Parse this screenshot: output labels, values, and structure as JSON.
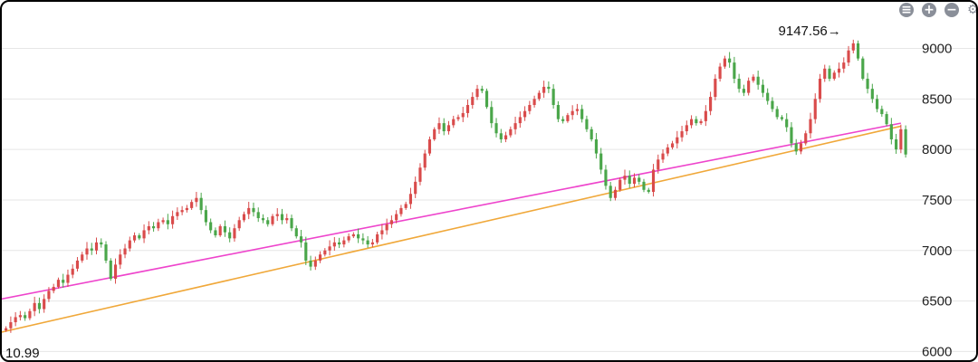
{
  "toolbar": {
    "buttons": [
      {
        "name": "menu-icon",
        "glyph": "≡"
      },
      {
        "name": "zoom-in-icon",
        "glyph": "+"
      },
      {
        "name": "zoom-out-icon",
        "glyph": "−"
      },
      {
        "name": "settings-icon",
        "glyph": "⚙"
      }
    ]
  },
  "chart_data": {
    "type": "candlestick",
    "y_axis": {
      "min": 5950,
      "max": 9300,
      "ticks": [
        6000,
        6500,
        7000,
        7500,
        8000,
        8500,
        9000
      ],
      "position": "right"
    },
    "grid": true,
    "colors": {
      "up": "#d94b4b",
      "down": "#4aa64a",
      "trendline_1": "#ee44cc",
      "trendline_2": "#f0a83a"
    },
    "annotations": [
      {
        "text": "9147.56→",
        "index": 176,
        "value": 9147.56,
        "kind": "max"
      },
      {
        "text": "10.99",
        "index": 0,
        "value": 6210.99,
        "kind": "min"
      }
    ],
    "trendlines": [
      {
        "name": "",
        "start": {
          "index": -2,
          "value": 6510
        },
        "end": {
          "index": 188,
          "value": 8260
        }
      },
      {
        "name": "",
        "start": {
          "index": -2,
          "value": 6180
        },
        "end": {
          "index": 188,
          "value": 8230
        }
      }
    ],
    "closes": [
      6230,
      6290,
      6340,
      6360,
      6330,
      6400,
      6480,
      6420,
      6520,
      6600,
      6640,
      6710,
      6680,
      6760,
      6820,
      6900,
      6960,
      7020,
      7000,
      7080,
      7060,
      6900,
      6720,
      6860,
      6960,
      7020,
      7100,
      7150,
      7120,
      7200,
      7240,
      7220,
      7280,
      7300,
      7260,
      7340,
      7380,
      7400,
      7420,
      7480,
      7520,
      7400,
      7280,
      7200,
      7150,
      7240,
      7180,
      7120,
      7220,
      7300,
      7360,
      7420,
      7380,
      7320,
      7300,
      7260,
      7340,
      7360,
      7300,
      7320,
      7220,
      7140,
      7080,
      6900,
      6840,
      6900,
      6960,
      7000,
      7040,
      7080,
      7060,
      7100,
      7140,
      7160,
      7120,
      7100,
      7060,
      7080,
      7160,
      7200,
      7260,
      7300,
      7360,
      7420,
      7460,
      7560,
      7680,
      7820,
      7960,
      8100,
      8200,
      8260,
      8180,
      8240,
      8300,
      8320,
      8360,
      8440,
      8520,
      8600,
      8580,
      8420,
      8260,
      8160,
      8100,
      8140,
      8200,
      8260,
      8320,
      8380,
      8440,
      8500,
      8560,
      8620,
      8600,
      8440,
      8300,
      8280,
      8340,
      8380,
      8400,
      8300,
      8200,
      8100,
      7960,
      7800,
      7640,
      7520,
      7600,
      7700,
      7740,
      7660,
      7720,
      7680,
      7600,
      7580,
      7800,
      7900,
      7960,
      8020,
      8060,
      8120,
      8180,
      8240,
      8300,
      8260,
      8280,
      8380,
      8520,
      8700,
      8820,
      8900,
      8860,
      8700,
      8600,
      8560,
      8680,
      8720,
      8640,
      8560,
      8480,
      8400,
      8320,
      8300,
      8220,
      8060,
      7980,
      8060,
      8160,
      8300,
      8500,
      8700,
      8800,
      8700,
      8760,
      8800,
      8860,
      8980,
      9050,
      8900,
      8700,
      8600,
      8500,
      8400,
      8350,
      8250,
      8100,
      8000,
      8200,
      7950
    ]
  }
}
